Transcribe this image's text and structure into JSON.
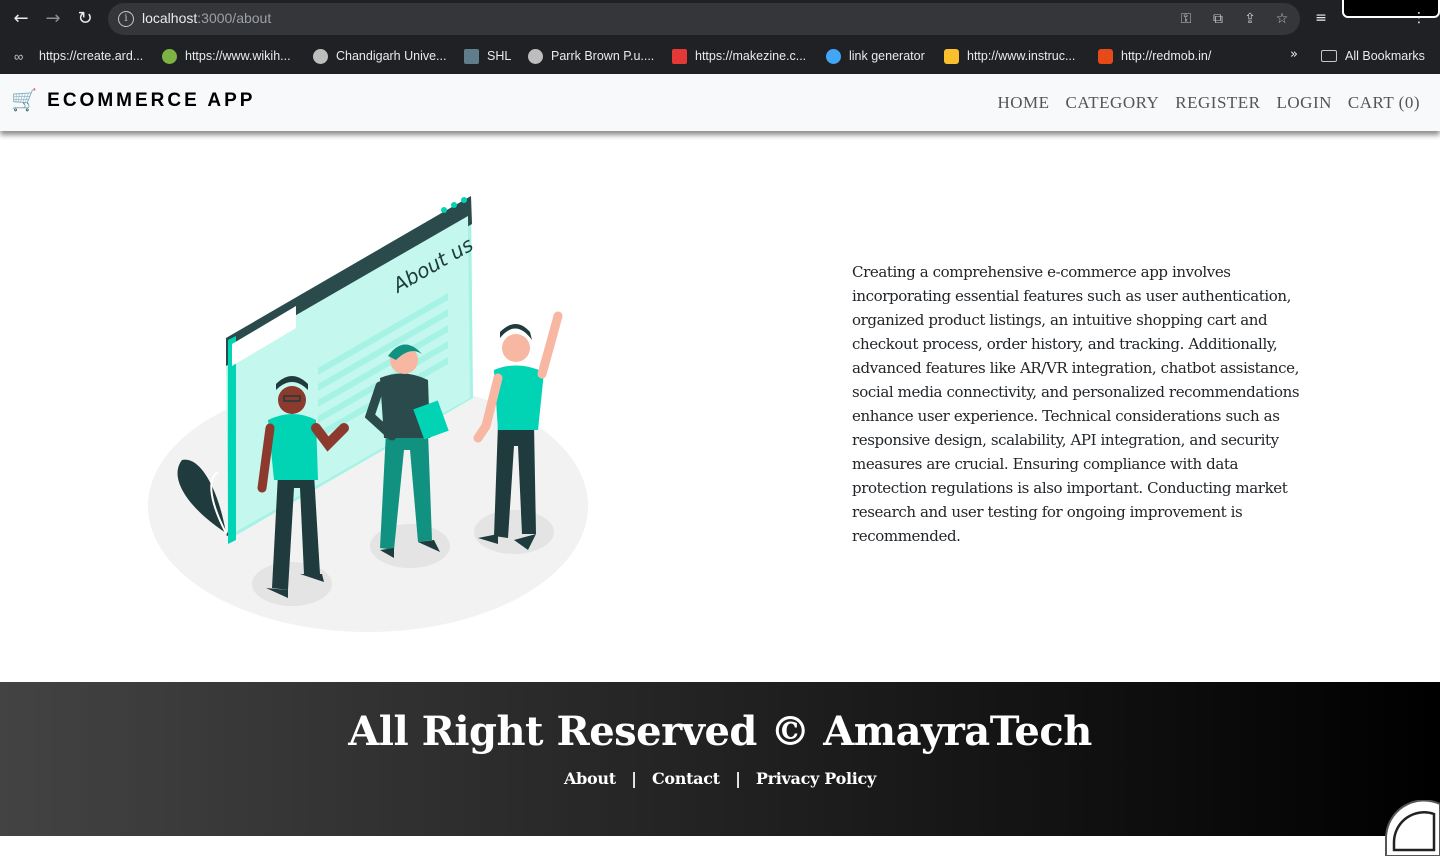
{
  "browser": {
    "url_host": "localhost",
    "url_path": ":3000/about",
    "bookmarks": [
      {
        "label": "https://create.ard...",
        "color": "#9aa0a6"
      },
      {
        "label": "https://www.wikih...",
        "color": "#7cb342"
      },
      {
        "label": "Chandigarh Unive...",
        "color": "#bdbdbd"
      },
      {
        "label": "SHL",
        "color": "#607d8b"
      },
      {
        "label": "Parrk Brown P.u....",
        "color": "#bdbdbd"
      },
      {
        "label": "https://makezine.c...",
        "color": "#e53935"
      },
      {
        "label": "link generator",
        "color": "#42a5f5"
      },
      {
        "label": "http://www.instruc...",
        "color": "#fbc02d"
      },
      {
        "label": "http://redmob.in/",
        "color": "#e64a19"
      }
    ],
    "more_label": "»",
    "all_bookmarks": "All Bookmarks"
  },
  "navbar": {
    "brand": "ECOMMERCE APP",
    "brand_icon": "🛒",
    "menu": [
      "HOME",
      "CATEGORY",
      "REGISTER",
      "LOGIN",
      "CART (0)"
    ]
  },
  "about": {
    "illustration_heading": "About us",
    "text": "Creating a comprehensive e-commerce app involves incorporating essential features such as user authentication, organized product listings, an intuitive shopping cart and checkout process, order history, and tracking. Additionally, advanced features like AR/VR integration, chatbot assistance, social media connectivity, and personalized recommendations enhance user experience. Technical considerations such as responsive design, scalability, API integration, and security measures are crucial. Ensuring compliance with data protection regulations is also important. Conducting market research and user testing for ongoing improvement is recommended."
  },
  "footer": {
    "title": "All Right Reserved © AmayraTech",
    "links": [
      "About",
      "Contact",
      "Privacy Policy"
    ],
    "separator": "|"
  },
  "colors": {
    "accent": "#00d4b4",
    "footer_start": "#434343",
    "footer_end": "#000000"
  }
}
